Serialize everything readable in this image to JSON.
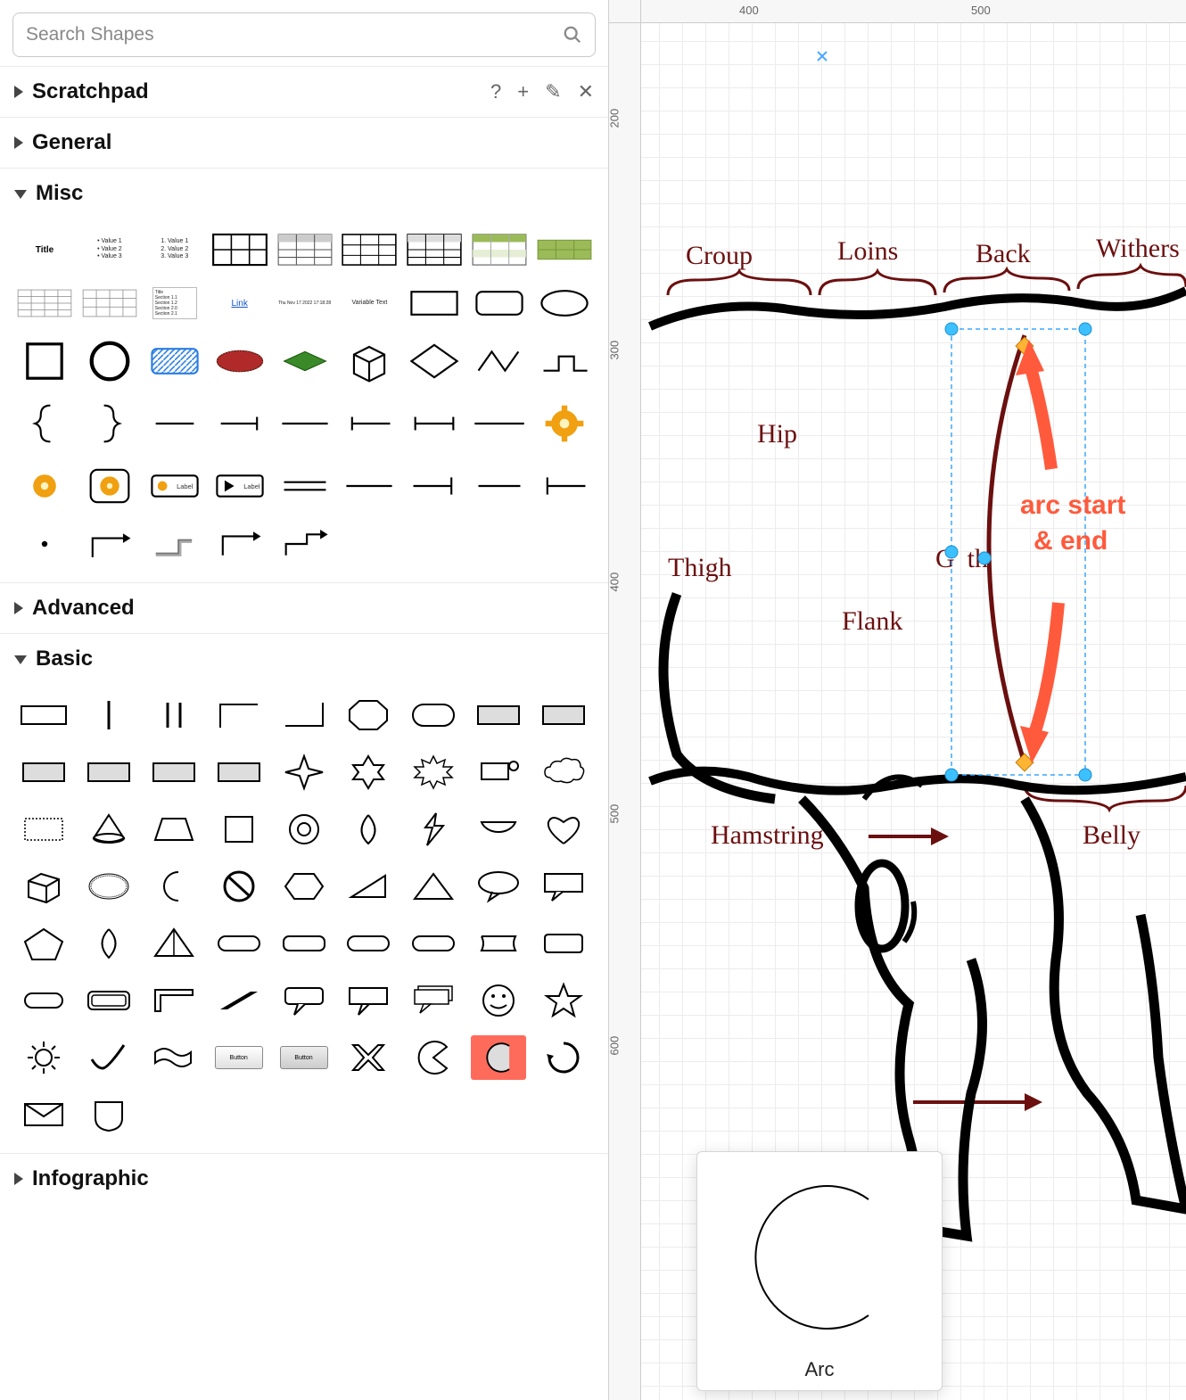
{
  "search": {
    "placeholder": "Search Shapes"
  },
  "sections": {
    "scratchpad": {
      "title": "Scratchpad",
      "open": false
    },
    "general": {
      "title": "General",
      "open": false
    },
    "misc": {
      "title": "Misc",
      "open": true
    },
    "advanced": {
      "title": "Advanced",
      "open": false
    },
    "basic": {
      "title": "Basic",
      "open": true
    },
    "infographic": {
      "title": "Infographic",
      "open": false
    }
  },
  "scratchpad_actions": {
    "help": "?",
    "add": "+",
    "edit": "✎",
    "close": "✕"
  },
  "misc_sample_text": {
    "title": "Title",
    "bullets": [
      "Value 1",
      "Value 2",
      "Value 3"
    ],
    "numbered": [
      "1. Value 1",
      "2. Value 2",
      "3. Value 3"
    ],
    "link": "Link",
    "timestamp": "Thu Nov 17 2022 17:18:28",
    "variable": "Variable Text",
    "label": "Label"
  },
  "basic_buttons": {
    "b1": "Button",
    "b2": "Button"
  },
  "rulers": {
    "h": [
      "400",
      "500"
    ],
    "v": [
      "200",
      "300",
      "400",
      "500",
      "600"
    ]
  },
  "horse_labels": {
    "croup": "Croup",
    "loins": "Loins",
    "back": "Back",
    "withers": "Withers",
    "hip": "Hip",
    "girth": "Girth",
    "thigh": "Thigh",
    "flank": "Flank",
    "hamstring": "Hamstring",
    "belly": "Belly"
  },
  "annotation": {
    "line1": "arc start",
    "line2": "& end"
  },
  "preview": {
    "caption": "Arc"
  },
  "colors": {
    "highlight": "#ff6b5b",
    "label": "#6b0f0f",
    "annotation": "#ff5a3c",
    "selection": "#3dc0ff",
    "diamond": "#ffb434"
  }
}
